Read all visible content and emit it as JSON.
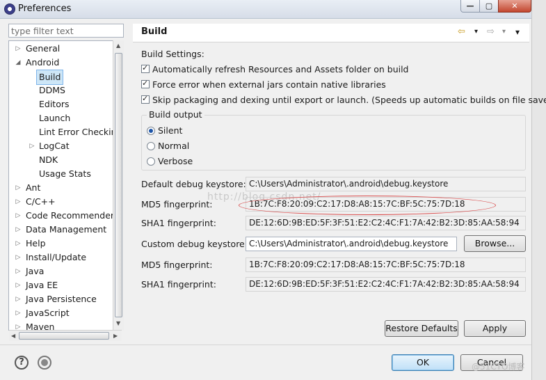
{
  "window": {
    "title": "Preferences",
    "min_glyph": "—",
    "max_glyph": "▢",
    "close_glyph": "✕"
  },
  "filter": {
    "placeholder": "type filter text"
  },
  "tree": {
    "items": [
      {
        "label": "General",
        "level": 0,
        "twisty": "▷"
      },
      {
        "label": "Android",
        "level": 0,
        "twisty": "◢"
      },
      {
        "label": "Build",
        "level": 1,
        "twisty": "",
        "selected": true
      },
      {
        "label": "DDMS",
        "level": 1,
        "twisty": ""
      },
      {
        "label": "Editors",
        "level": 1,
        "twisty": ""
      },
      {
        "label": "Launch",
        "level": 1,
        "twisty": ""
      },
      {
        "label": "Lint Error Checking",
        "level": 1,
        "twisty": ""
      },
      {
        "label": "LogCat",
        "level": 1,
        "twisty": "▷"
      },
      {
        "label": "NDK",
        "level": 1,
        "twisty": ""
      },
      {
        "label": "Usage Stats",
        "level": 1,
        "twisty": ""
      },
      {
        "label": "Ant",
        "level": 0,
        "twisty": "▷"
      },
      {
        "label": "C/C++",
        "level": 0,
        "twisty": "▷"
      },
      {
        "label": "Code Recommenders",
        "level": 0,
        "twisty": "▷"
      },
      {
        "label": "Data Management",
        "level": 0,
        "twisty": "▷"
      },
      {
        "label": "Help",
        "level": 0,
        "twisty": "▷"
      },
      {
        "label": "Install/Update",
        "level": 0,
        "twisty": "▷"
      },
      {
        "label": "Java",
        "level": 0,
        "twisty": "▷"
      },
      {
        "label": "Java EE",
        "level": 0,
        "twisty": "▷"
      },
      {
        "label": "Java Persistence",
        "level": 0,
        "twisty": "▷"
      },
      {
        "label": "JavaScript",
        "level": 0,
        "twisty": "▷"
      },
      {
        "label": "Maven",
        "level": 0,
        "twisty": "▷"
      }
    ]
  },
  "page": {
    "title": "Build",
    "nav_back": "⇦",
    "nav_forward": "⇨",
    "dropdown": "▾",
    "build_settings_label": "Build Settings:",
    "checkboxes": [
      {
        "label": "Automatically refresh Resources and Assets folder on build",
        "checked": true
      },
      {
        "label": "Force error when external jars contain native libraries",
        "checked": true
      },
      {
        "label": "Skip packaging and dexing until export or launch. (Speeds up automatic builds on file save)",
        "checked": true
      }
    ],
    "build_output": {
      "legend": "Build output",
      "options": [
        {
          "label": "Silent",
          "selected": true
        },
        {
          "label": "Normal",
          "selected": false
        },
        {
          "label": "Verbose",
          "selected": false
        }
      ]
    },
    "default_keystore_label": "Default debug keystore:",
    "default_keystore_value": "C:\\Users\\Administrator\\.android\\debug.keystore",
    "md5_label": "MD5 fingerprint:",
    "md5_value": "1B:7C:F8:20:09:C2:17:D8:A8:15:7C:BF:5C:75:7D:18",
    "sha1_label": "SHA1 fingerprint:",
    "sha1_value": "DE:12:6D:9B:ED:5F:3F:51:E2:C2:4C:F1:7A:42:B2:3D:85:AA:58:94",
    "custom_keystore_label": "Custom debug keystore:",
    "custom_keystore_value": "C:\\Users\\Administrator\\.android\\debug.keystore",
    "browse_label": "Browse...",
    "custom_md5_label": "MD5 fingerprint:",
    "custom_md5_value": "1B:7C:F8:20:09:C2:17:D8:A8:15:7C:BF:5C:75:7D:18",
    "custom_sha1_label": "SHA1 fingerprint:",
    "custom_sha1_value": "DE:12:6D:9B:ED:5F:3F:51:E2:C2:4C:F1:7A:42:B2:3D:85:AA:58:94",
    "restore_defaults_label": "Restore Defaults",
    "apply_label": "Apply"
  },
  "footer": {
    "ok_label": "OK",
    "cancel_label": "Cancel",
    "help_glyph": "?"
  },
  "watermark": {
    "center": "http://blog.csdn.net/",
    "bottom": "@51CTO博客"
  },
  "colors": {
    "annotation_ellipse": "#d94c4c",
    "selection": "#cde6f7",
    "close_button": "#c3472f"
  }
}
